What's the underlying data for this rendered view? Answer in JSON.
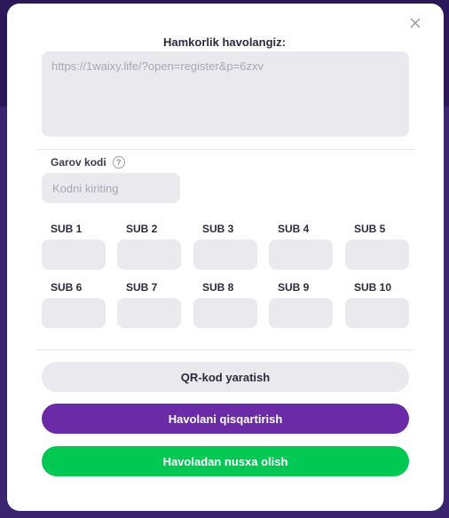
{
  "modal": {
    "title": "Hamkorlik havolangiz:",
    "link_value": "https://1waixy.life/?open=register&p=6zxv"
  },
  "promo": {
    "label": "Garov kodi",
    "help_glyph": "?",
    "placeholder": "Kodni kiriting"
  },
  "subs": [
    {
      "label": "SUB 1"
    },
    {
      "label": "SUB 2"
    },
    {
      "label": "SUB 3"
    },
    {
      "label": "SUB 4"
    },
    {
      "label": "SUB 5"
    },
    {
      "label": "SUB 6"
    },
    {
      "label": "SUB 7"
    },
    {
      "label": "SUB 8"
    },
    {
      "label": "SUB 9"
    },
    {
      "label": "SUB 10"
    }
  ],
  "buttons": {
    "qr": "QR-kod yaratish",
    "shorten": "Havolani qisqartirish",
    "copy": "Havoladan nusxa olish"
  },
  "colors": {
    "primary_purple": "#6b2ba6",
    "success_green": "#00c853",
    "input_bg": "#e9e9ee"
  },
  "icons": {
    "close": "close-icon",
    "help": "help-icon"
  }
}
